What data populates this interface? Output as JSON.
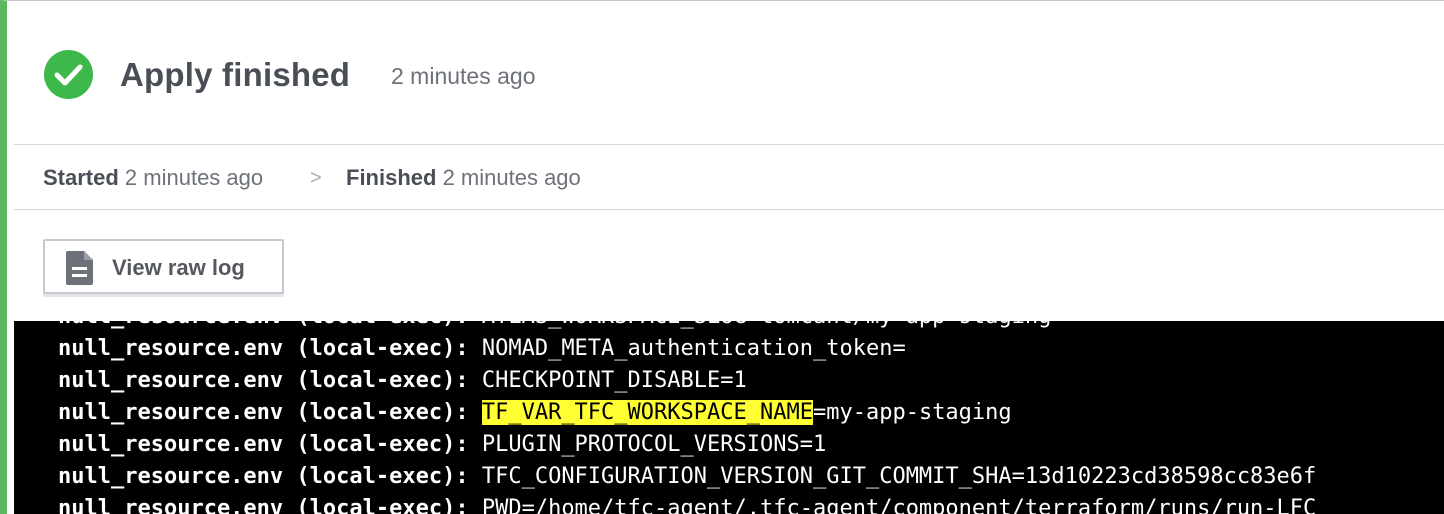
{
  "header": {
    "status_icon": "check-circle-icon",
    "status_color": "#3db84a",
    "title": "Apply finished",
    "time": "2 minutes ago"
  },
  "timeline": {
    "started_label": "Started",
    "started_time": "2 minutes ago",
    "separator": ">",
    "finished_label": "Finished",
    "finished_time": "2 minutes ago"
  },
  "toolbar": {
    "view_raw_log_icon": "document-icon",
    "view_raw_log_label": "View raw log"
  },
  "log": {
    "lines": [
      {
        "prefix": "null_resource.env (local-exec): ",
        "text": "ATLAS_WORKSPACE_SLUG=tomcant/my-app-staging",
        "highlight": "",
        "rest": ""
      },
      {
        "prefix": "null_resource.env (local-exec): ",
        "text": "NOMAD_META_authentication_token=",
        "highlight": "",
        "rest": ""
      },
      {
        "prefix": "null_resource.env (local-exec): ",
        "text": "CHECKPOINT_DISABLE=1",
        "highlight": "",
        "rest": ""
      },
      {
        "prefix": "null_resource.env (local-exec): ",
        "text": "",
        "highlight": "TF_VAR_TFC_WORKSPACE_NAME",
        "rest": "=my-app-staging"
      },
      {
        "prefix": "null_resource.env (local-exec): ",
        "text": "PLUGIN_PROTOCOL_VERSIONS=1",
        "highlight": "",
        "rest": ""
      },
      {
        "prefix": "null_resource.env (local-exec): ",
        "text": "TFC_CONFIGURATION_VERSION_GIT_COMMIT_SHA=13d10223cd38598cc83e6f",
        "highlight": "",
        "rest": ""
      },
      {
        "prefix": "null_resource.env (local-exec): ",
        "text": "PWD=/home/tfc-agent/.tfc-agent/component/terraform/runs/run-LFC",
        "highlight": "",
        "rest": ""
      }
    ]
  }
}
